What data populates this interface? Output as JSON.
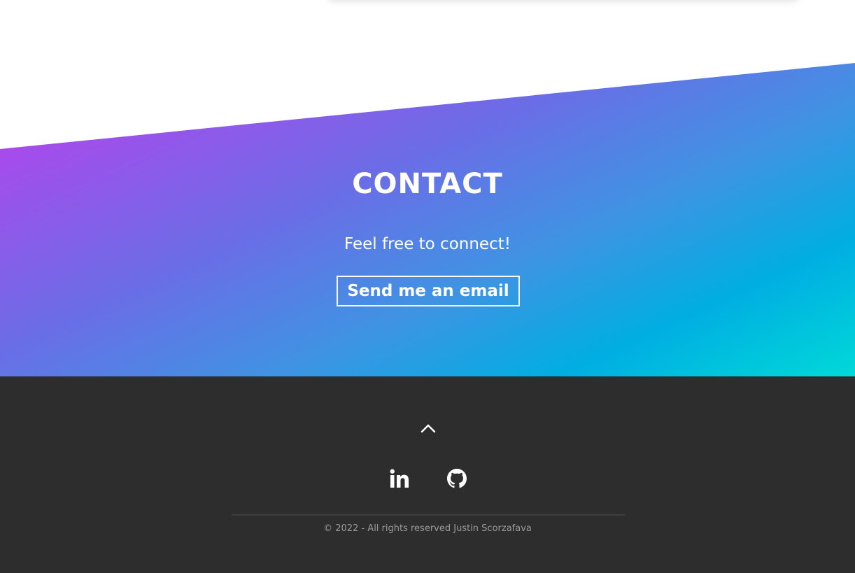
{
  "contact": {
    "title": "CONTACT",
    "subtitle": "Feel free to connect!",
    "email_button_label": "Send me an email"
  },
  "footer": {
    "back_to_top_icon": "chevron-up-icon",
    "social": [
      {
        "name": "linkedin",
        "icon": "linkedin-icon"
      },
      {
        "name": "github",
        "icon": "github-icon"
      }
    ],
    "copyright": "© 2022 - All rights reserved Justin Scorzafava"
  },
  "colors": {
    "gradient_start": "#e43cf2",
    "gradient_mid": "#6b6de6",
    "gradient_end": "#00d9d8",
    "footer_bg": "#2d2d2d",
    "footer_text": "#9a9a9a"
  }
}
